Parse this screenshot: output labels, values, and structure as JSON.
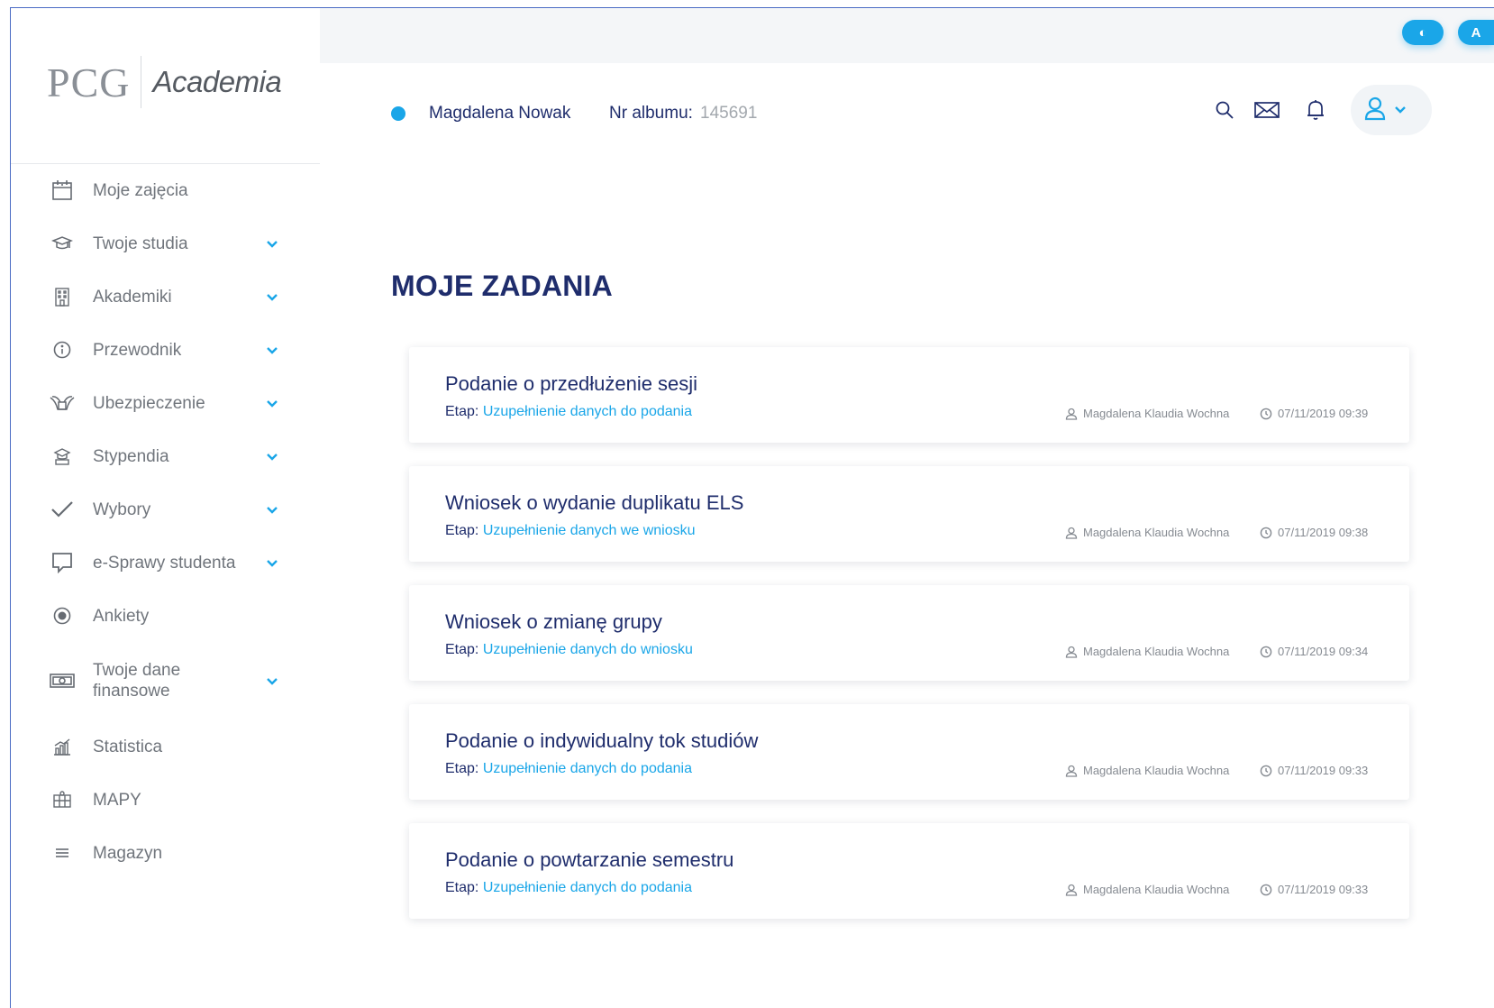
{
  "top_badges": [
    "◐",
    "A"
  ],
  "logo": {
    "brand": "PCG",
    "product": "Academia"
  },
  "sidebar": {
    "items": [
      {
        "label": "Moje zajęcia",
        "icon": "calendar-icon",
        "has_submenu": false
      },
      {
        "label": "Twoje studia",
        "icon": "graduation-cap-icon",
        "has_submenu": true
      },
      {
        "label": "Akademiki",
        "icon": "building-icon",
        "has_submenu": true
      },
      {
        "label": "Przewodnik",
        "icon": "info-icon",
        "has_submenu": true
      },
      {
        "label": "Ubezpieczenie",
        "icon": "insurance-icon",
        "has_submenu": true
      },
      {
        "label": "Stypendia",
        "icon": "scholarship-icon",
        "has_submenu": true
      },
      {
        "label": "Wybory",
        "icon": "checkmark-icon",
        "has_submenu": true
      },
      {
        "label": "e-Sprawy studenta",
        "icon": "chat-bubble-icon",
        "has_submenu": true
      },
      {
        "label": "Ankiety",
        "icon": "radio-dot-icon",
        "has_submenu": false
      },
      {
        "label": "Twoje dane finansowe",
        "icon": "money-icon",
        "has_submenu": true
      },
      {
        "label": "Statistica",
        "icon": "statistics-icon",
        "has_submenu": false
      },
      {
        "label": "MAPY",
        "icon": "map-icon",
        "has_submenu": false
      },
      {
        "label": "Magazyn",
        "icon": "menu-lines-icon",
        "has_submenu": false
      }
    ]
  },
  "header": {
    "user_name": "Magdalena Nowak",
    "album_label": "Nr albumu:",
    "album_value": "145691"
  },
  "main": {
    "title": "MOJE ZADANIA",
    "stage_prefix": "Etap:",
    "tasks": [
      {
        "title": "Podanie o przedłużenie sesji",
        "stage": "Uzupełnienie danych do podania",
        "author": "Magdalena Klaudia Wochna",
        "datetime": "07/11/2019 09:39"
      },
      {
        "title": "Wniosek o wydanie duplikatu ELS",
        "stage": "Uzupełnienie danych we wniosku",
        "author": "Magdalena Klaudia Wochna",
        "datetime": "07/11/2019 09:38"
      },
      {
        "title": "Wniosek o zmianę grupy",
        "stage": "Uzupełnienie danych do wniosku",
        "author": "Magdalena Klaudia Wochna",
        "datetime": "07/11/2019 09:34"
      },
      {
        "title": "Podanie o indywidualny tok studiów",
        "stage": "Uzupełnienie danych do podania",
        "author": "Magdalena Klaudia Wochna",
        "datetime": "07/11/2019 09:33"
      },
      {
        "title": "Podanie o powtarzanie semestru",
        "stage": "Uzupełnienie danych do podania",
        "author": "Magdalena Klaudia Wochna",
        "datetime": "07/11/2019 09:33"
      }
    ]
  },
  "colors": {
    "accent": "#1aa6e8",
    "navy": "#1f2d6c",
    "text_muted": "#70757c"
  }
}
